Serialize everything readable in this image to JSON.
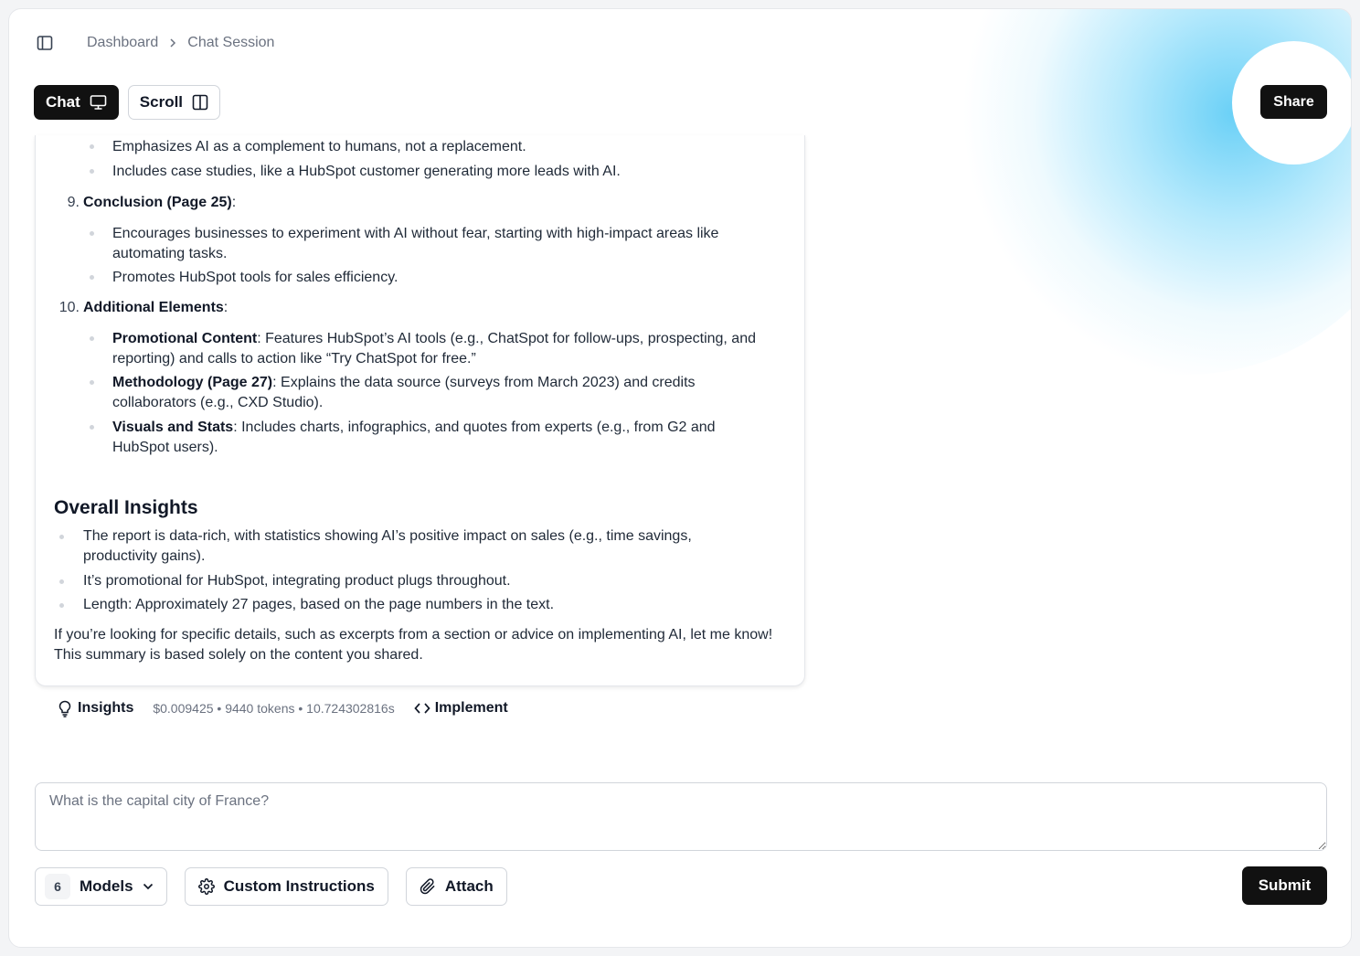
{
  "breadcrumb": {
    "items": [
      "Dashboard",
      "Chat Session"
    ]
  },
  "view_toggle": {
    "chat_label": "Chat",
    "scroll_label": "Scroll",
    "active": "Chat"
  },
  "share_label": "Share",
  "message": {
    "item8_bullets": [
      "Emphasizes AI as a complement to humans, not a replacement.",
      "Includes case studies, like a HubSpot customer generating more leads with AI."
    ],
    "item9": {
      "number": "9.",
      "title": "Conclusion (Page 25)",
      "suffix": ":",
      "bullets": [
        "Encourages businesses to experiment with AI without fear, starting with high-impact areas like automating tasks.",
        "Promotes HubSpot tools for sales efficiency."
      ]
    },
    "item10": {
      "number": "10.",
      "title": "Additional Elements",
      "suffix": ":",
      "bullets": [
        {
          "bold": "Promotional Content",
          "text": ": Features HubSpot’s AI tools (e.g., ChatSpot for follow-ups, prospecting, and reporting) and calls to action like “Try ChatSpot for free.”"
        },
        {
          "bold": "Methodology (Page 27)",
          "text": ": Explains the data source (surveys from March 2023) and credits collaborators (e.g., CXD Studio)."
        },
        {
          "bold": "Visuals and Stats",
          "text": ": Includes charts, infographics, and quotes from experts (e.g., from G2 and HubSpot users)."
        }
      ]
    },
    "insights_heading": "Overall Insights",
    "insights_bullets": [
      "The report is data-rich, with statistics showing AI’s positive impact on sales (e.g., time savings, productivity gains).",
      "It’s promotional for HubSpot, integrating product plugs throughout.",
      "Length: Approximately 27 pages, based on the page numbers in the text."
    ],
    "closing": "If you’re looking for specific details, such as excerpts from a section or advice on implementing AI, let me know! This summary is based solely on the content you shared."
  },
  "stats": {
    "insights_label": "Insights",
    "metrics": "$0.009425 • 9440 tokens • 10.724302816s",
    "implement_label": "Implement"
  },
  "prompt": {
    "placeholder": "What is the capital city of France?",
    "value": ""
  },
  "controls": {
    "models_count": "6",
    "models_label": "Models",
    "custom_instructions_label": "Custom Instructions",
    "attach_label": "Attach",
    "submit_label": "Submit"
  },
  "icons": {
    "sidebar_toggle": "sidebar-toggle-icon",
    "breadcrumb_separator": "chevron-right-icon",
    "chat": "monitor-icon",
    "scroll": "columns-icon",
    "insights": "lightbulb-icon",
    "implement": "code-icon",
    "models": "chevron-down-icon",
    "custom_instructions": "gear-icon",
    "attach": "paperclip-icon"
  },
  "colors": {
    "primary": "#111111",
    "accent_glow": "#50c8f5"
  }
}
